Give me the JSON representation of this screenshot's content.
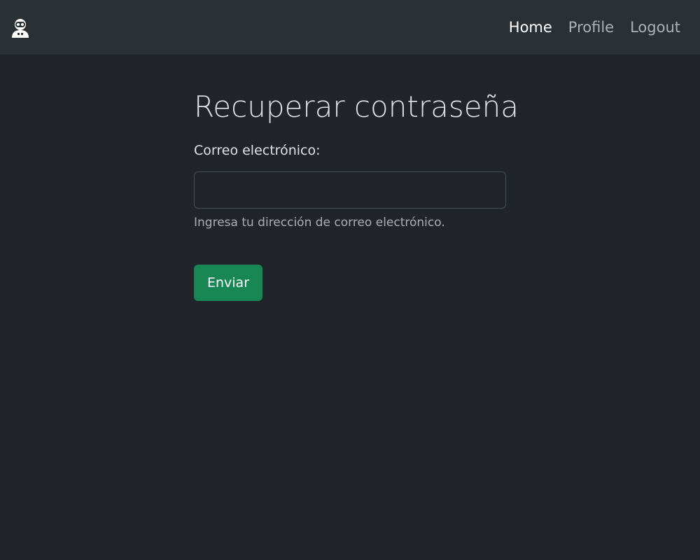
{
  "navbar": {
    "logo_icon": "robot-avatar-icon",
    "links": [
      {
        "label": "Home",
        "active": true
      },
      {
        "label": "Profile",
        "active": false
      },
      {
        "label": "Logout",
        "active": false
      }
    ]
  },
  "form": {
    "title": "Recuperar contraseña",
    "email_label": "Correo electrónico:",
    "email_value": "",
    "email_placeholder": "",
    "help_text": "Ingresa tu dirección de correo electrónico.",
    "submit_label": "Enviar"
  },
  "colors": {
    "background": "#212529",
    "navbar": "#2b3035",
    "primary_button": "#198754"
  }
}
